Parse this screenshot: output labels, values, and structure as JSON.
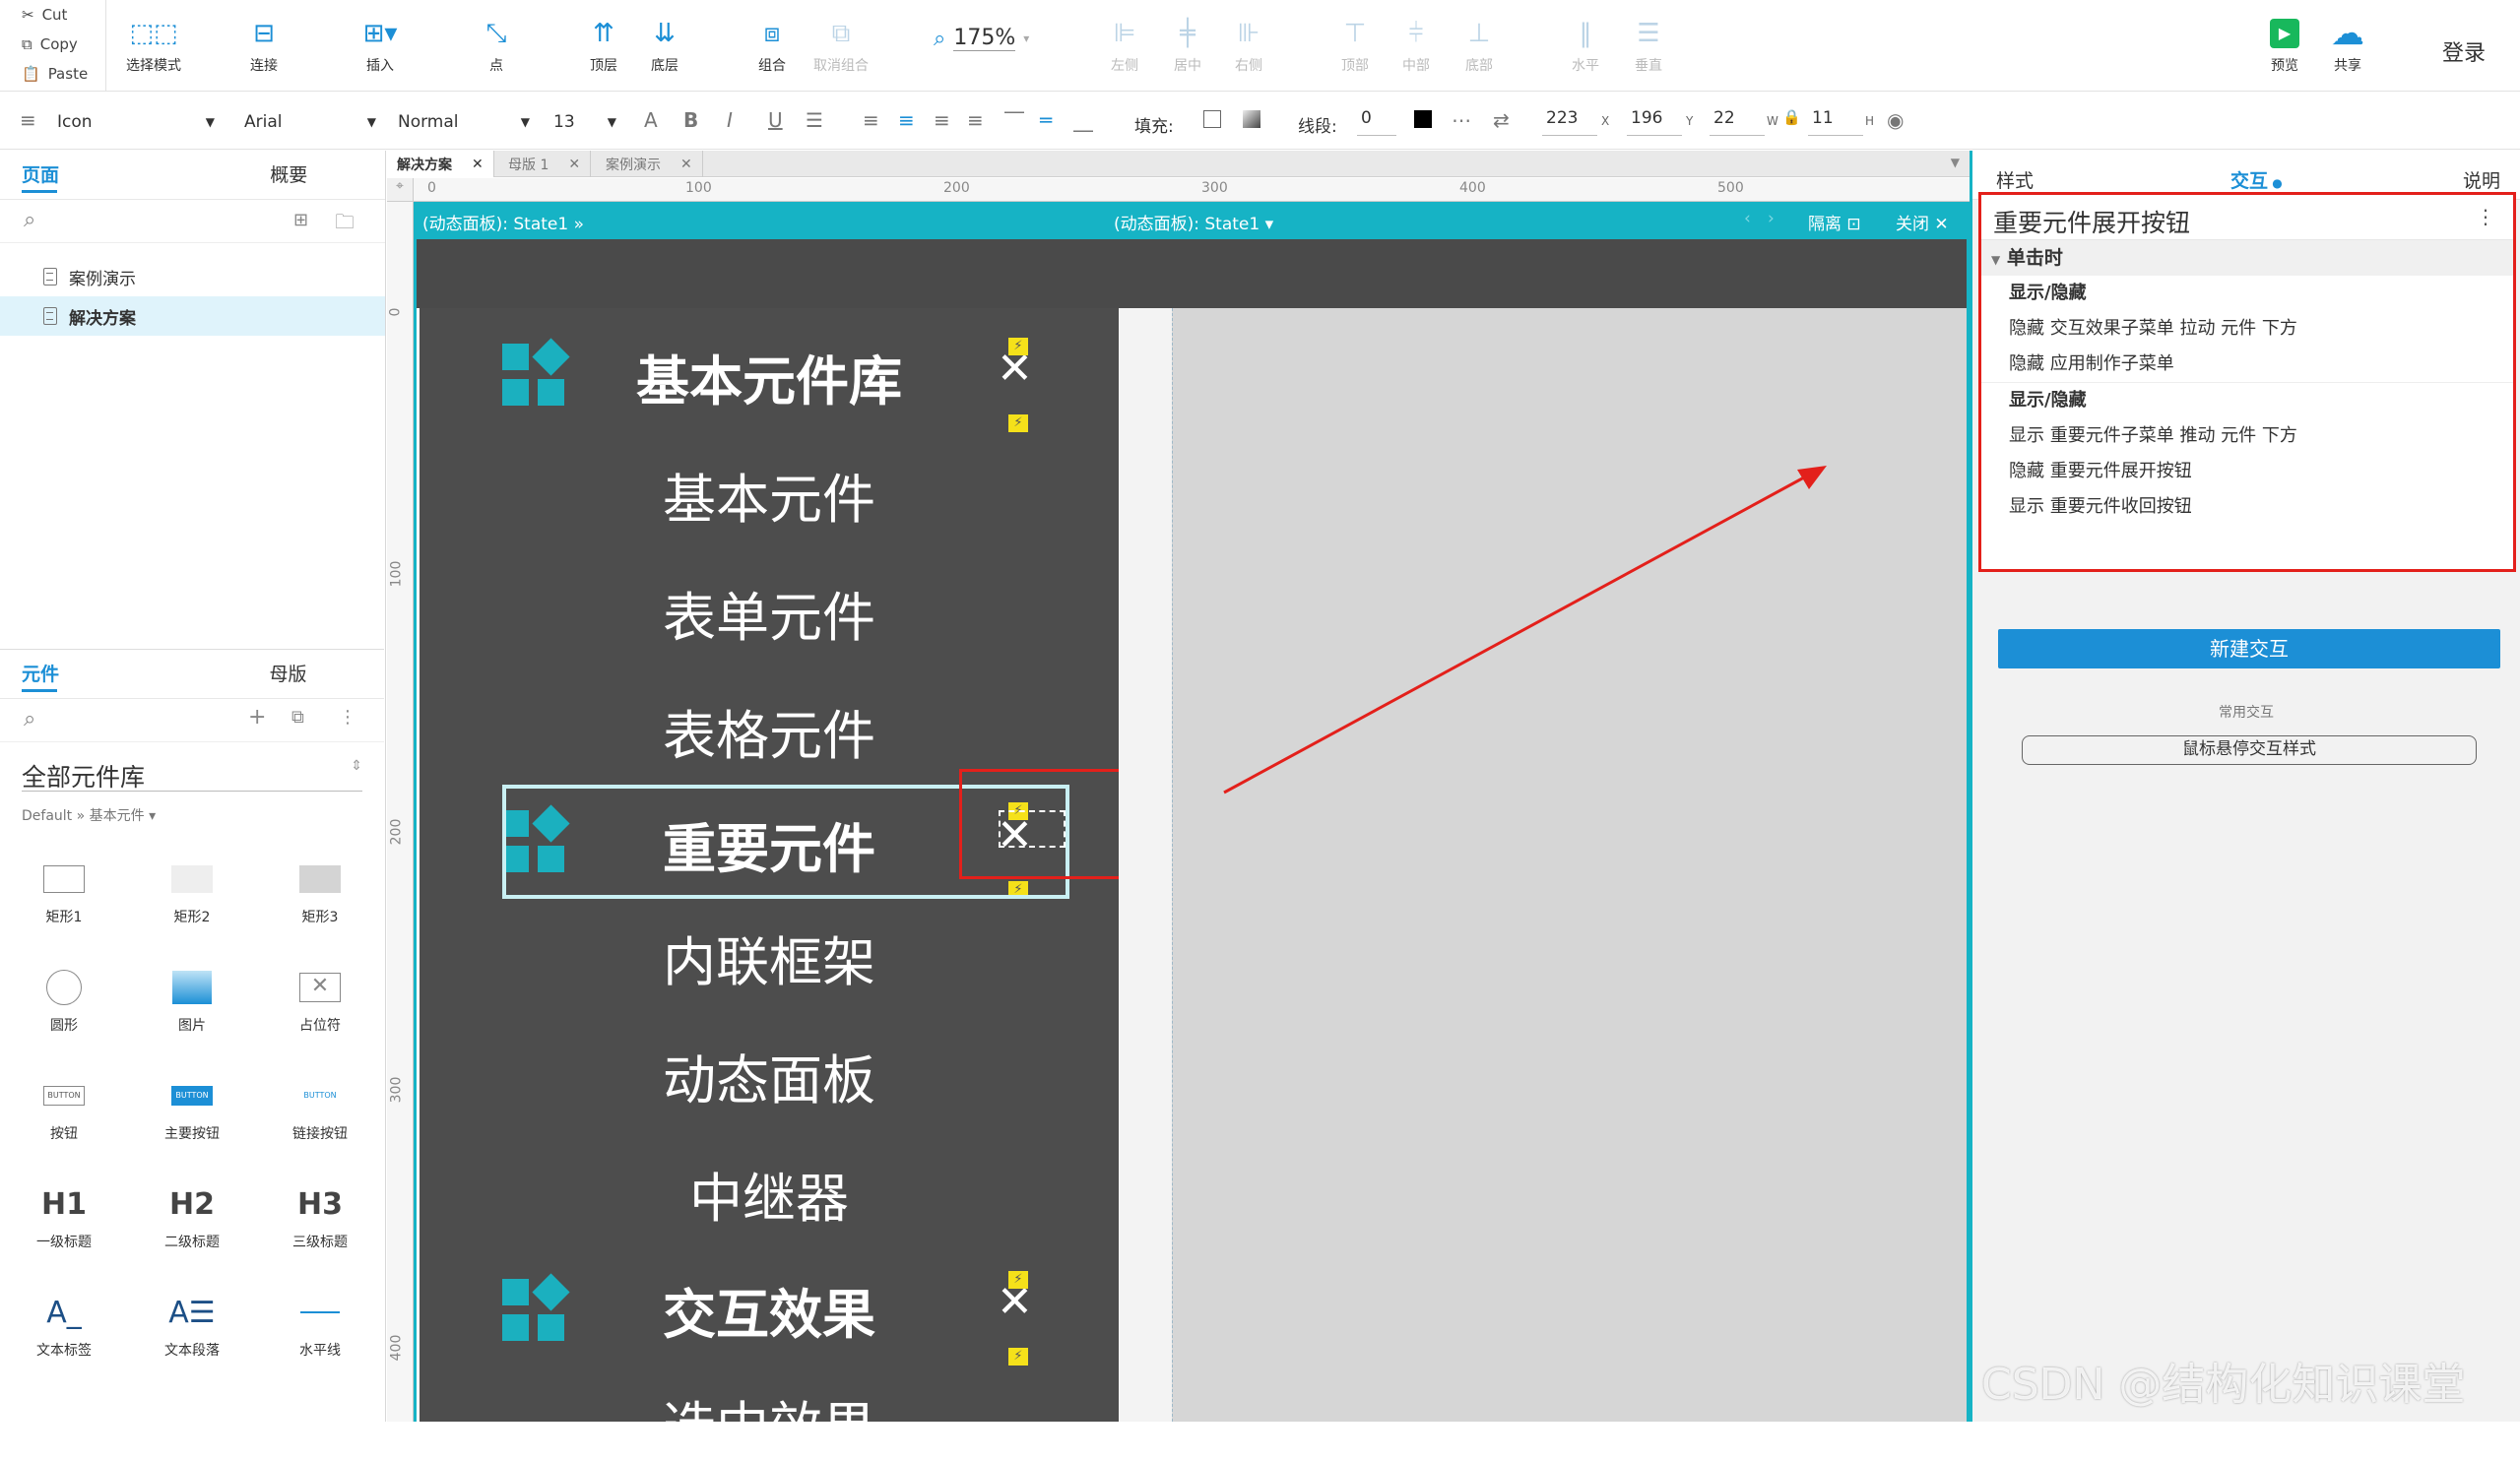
{
  "toolbar": {
    "cut": "Cut",
    "copy": "Copy",
    "paste": "Paste",
    "select_mode": "选择模式",
    "connect": "连接",
    "insert": "插入",
    "point": "点",
    "top_layer": "顶层",
    "bottom_layer": "底层",
    "group": "组合",
    "ungroup": "取消组合",
    "zoom": "175%",
    "align_left": "左侧",
    "align_center": "居中",
    "align_right": "右侧",
    "align_top": "顶部",
    "align_middle": "中部",
    "align_bottom": "底部",
    "dist_h": "水平",
    "dist_v": "垂直",
    "preview": "预览",
    "share": "共享",
    "login": "登录"
  },
  "format": {
    "style": "Icon",
    "font": "Arial",
    "weight": "Normal",
    "size": "13",
    "fill_label": "填充:",
    "stroke_label": "线段:",
    "stroke_value": "0",
    "x": "223",
    "y": "196",
    "w": "22",
    "h": "11",
    "x_unit": "X",
    "y_unit": "Y",
    "w_unit": "W",
    "h_unit": "H"
  },
  "left": {
    "tab_pages": "页面",
    "tab_outline": "概要",
    "pages": [
      "案例演示",
      "解决方案"
    ],
    "tab_widgets": "元件",
    "tab_masters": "母版",
    "library": "全部元件库",
    "breadcrumb": "Default » 基本元件 ▾",
    "widgets": [
      "矩形1",
      "矩形2",
      "矩形3",
      "圆形",
      "图片",
      "占位符",
      "按钮",
      "主要按钮",
      "链接按钮",
      "一级标题",
      "二级标题",
      "三级标题",
      "文本标签",
      "文本段落",
      "水平线"
    ],
    "btn_text": "BUTTON",
    "h1": "H1",
    "h2": "H2",
    "h3": "H3"
  },
  "canvas": {
    "tabs": [
      "解决方案",
      "母版 1",
      "案例演示"
    ],
    "ruler_top": [
      "0",
      "100",
      "200",
      "300",
      "400",
      "500"
    ],
    "ruler_left": [
      "0",
      "100",
      "200",
      "300",
      "400"
    ],
    "panel_left": "(动态面板): State1 »",
    "panel_center": "(动态面板): State1 ▾",
    "isolate": "隔离",
    "close": "关闭",
    "menu": [
      {
        "text": "基本元件库",
        "bold": true
      },
      {
        "text": "基本元件",
        "bold": false
      },
      {
        "text": "表单元件",
        "bold": false
      },
      {
        "text": "表格元件",
        "bold": false
      },
      {
        "text": "重要元件",
        "bold": true
      },
      {
        "text": "内联框架",
        "bold": false
      },
      {
        "text": "动态面板",
        "bold": false
      },
      {
        "text": "中继器",
        "bold": false
      },
      {
        "text": "交互效果",
        "bold": true
      },
      {
        "text": "选中效果",
        "bold": false
      }
    ]
  },
  "right": {
    "tab_style": "样式",
    "tab_interact": "交互",
    "tab_notes": "说明",
    "widget_name": "重要元件展开按钮",
    "event": "单击时",
    "actions": [
      {
        "title": "显示/隐藏",
        "lines": [
          "隐藏 交互效果子菜单  拉动 元件 下方",
          "隐藏 应用制作子菜单"
        ]
      },
      {
        "title": "显示/隐藏",
        "lines": [
          "显示 重要元件子菜单  推动 元件 下方",
          "隐藏 重要元件展开按钮",
          "显示 重要元件收回按钮"
        ]
      }
    ],
    "new_interaction": "新建交互",
    "common_label": "常用交互",
    "hover_style": "鼠标悬停交互样式"
  },
  "watermark": "CSDN @结构化知识课堂",
  "colors": {
    "accent": "#1c8fd6",
    "panel": "#16b3c5",
    "highlight": "#e3201b",
    "menu_bg": "#4d4d4d"
  }
}
